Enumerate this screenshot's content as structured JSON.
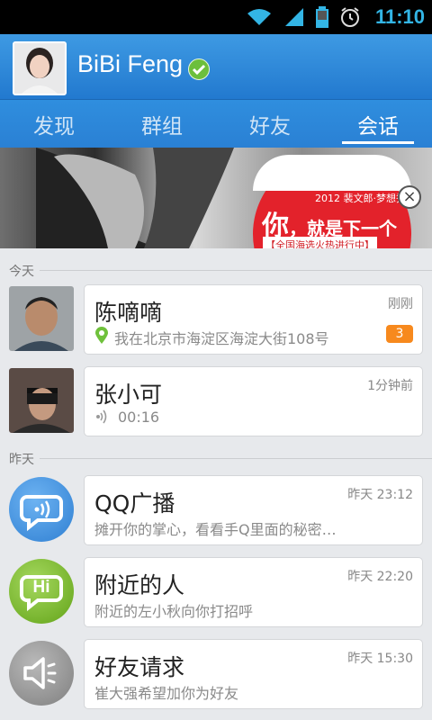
{
  "status": {
    "time": "11:10"
  },
  "profile": {
    "name": "BiBi Feng"
  },
  "tabs": [
    {
      "label": "发现",
      "active": false
    },
    {
      "label": "群组",
      "active": false
    },
    {
      "label": "好友",
      "active": false
    },
    {
      "label": "会话",
      "active": true
    }
  ],
  "banner": {
    "year_text": "2012 裴文郎·梦想秀",
    "main_text": "你",
    "main_text_2": "，",
    "main_text_3": "就是下一个",
    "sub_text": "【全国海选火热进行中】"
  },
  "sections": {
    "today": "今天",
    "yesterday": "昨天"
  },
  "conversations": [
    {
      "name": "陈嘀嘀",
      "preview": "我在北京市海淀区海淀大街108号",
      "time": "刚刚",
      "unread": "3"
    },
    {
      "name": "张小可",
      "preview": "00:16",
      "time": "1分钟前"
    },
    {
      "name": "QQ广播",
      "preview": "摊开你的掌心，看看手Q里面的秘密…",
      "time": "昨天 23:12"
    },
    {
      "name": "附近的人",
      "preview": "附近的左小秋向你打招呼",
      "time": "昨天 22:20",
      "icon_text": "Hi"
    },
    {
      "name": "好友请求",
      "preview": "崔大强希望加你为好友",
      "time": "昨天 15:30"
    }
  ],
  "colors": {
    "accent": "#2a80d4",
    "badge": "#f7891d",
    "broadcast": "#3d8fdb",
    "nearby": "#79b52a",
    "request": "#8e8e8e"
  }
}
